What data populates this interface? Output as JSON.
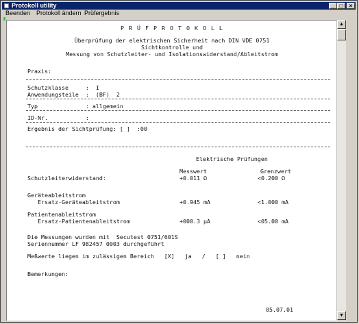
{
  "window": {
    "title": "Protokoll utility"
  },
  "menu": {
    "items": [
      "Beenden",
      "Protokoll ändern",
      "Prüfergebnis"
    ]
  },
  "titlebar_buttons": {
    "minimize": "_",
    "maximize": "□",
    "close": "×"
  },
  "doc": {
    "heading": "P R Ü F P R O T O K O L L",
    "subtitle1": "Überprüfung der elektrischen Sicherheit nach DIN VDE 0751",
    "subtitle2": "Sichtkontrolle und",
    "subtitle3": "Messung von Schutzleiter- und Isolationswiderstand/Ableitstrom",
    "praxis": "Praxis:",
    "schutzklasse": "Schutzklasse     :  I",
    "anwendungsteile": "Anwendungsteile  :  (BF)  2",
    "typ": "Typ              : allgemein",
    "id": "ID-Nr.           :",
    "sicht": "Ergebnis der Sichtprüfung: [ ]  :00",
    "section_title": "Elektrische Prüfungen",
    "col_messwert": "Messwert",
    "col_grenzwert": "Grenzwert",
    "rows": [
      {
        "label": "Schutzleiterwiderstand:",
        "mess": "+0.011 Ω",
        "grenz": "<0.200 Ω"
      },
      {
        "label": "Geräteableitstrom",
        "mess": "",
        "grenz": ""
      },
      {
        "label": "   Ersatz-Geräteableitstrom",
        "mess": "+0.945 mA",
        "grenz": "<1.000 mA"
      },
      {
        "label": "Patientenableitstrom",
        "mess": "",
        "grenz": ""
      },
      {
        "label": "   Ersatz-Patientenableitstrom",
        "mess": "+000.3 µA",
        "grenz": "<05.00 mA"
      }
    ],
    "messung1": "Die Messungen wurden mit  Secutest 0751/601S",
    "messung2": "Seriennummer LF 982457 0003 durchgeführt",
    "bereich": "Meßwerte liegen im zulässigen Bereich   [X]   ja   /   [ ]   nein",
    "bemerkungen": "Bemerkungen:",
    "date": "05.07.01"
  },
  "scrollbar": {
    "up_glyph": "▲",
    "down_glyph": "▼"
  }
}
